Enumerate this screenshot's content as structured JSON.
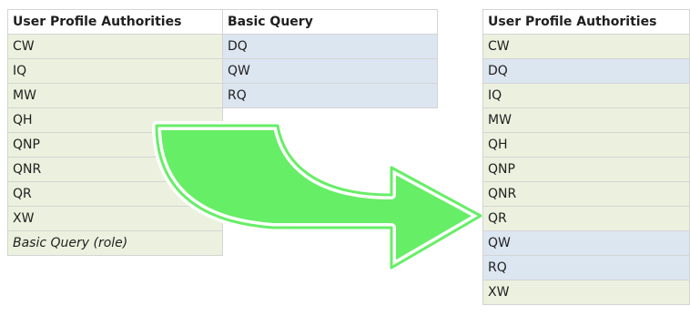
{
  "left_table": {
    "headers": [
      "User Profile Authorities",
      "Basic Query"
    ],
    "col1": [
      "CW",
      "IQ",
      "MW",
      "QH",
      "QNP",
      "QNR",
      "QR",
      "XW",
      "Basic Query (role)"
    ],
    "col2": [
      "DQ",
      "QW",
      "RQ"
    ]
  },
  "right_table": {
    "header": "User Profile Authorities",
    "rows": [
      {
        "value": "CW",
        "highlight": "green"
      },
      {
        "value": "DQ",
        "highlight": "blue"
      },
      {
        "value": "IQ",
        "highlight": "green"
      },
      {
        "value": "MW",
        "highlight": "green"
      },
      {
        "value": "QH",
        "highlight": "green"
      },
      {
        "value": "QNP",
        "highlight": "green"
      },
      {
        "value": "QNR",
        "highlight": "green"
      },
      {
        "value": "QR",
        "highlight": "green"
      },
      {
        "value": "QW",
        "highlight": "blue"
      },
      {
        "value": "RQ",
        "highlight": "blue"
      },
      {
        "value": "XW",
        "highlight": "green"
      }
    ]
  },
  "colors": {
    "green_cell": "#ebf1de",
    "blue_cell": "#dce6f1",
    "arrow_fill": "#66ee66",
    "arrow_stroke": "#ffffff"
  },
  "arrow_icon": "curved-arrow-right"
}
